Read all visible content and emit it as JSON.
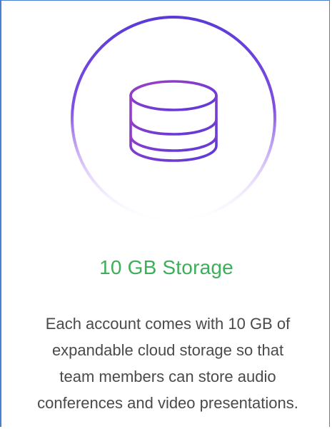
{
  "feature": {
    "icon": "database-icon",
    "accent_color": "#3fae5b",
    "ring_color": "#6a3bd6",
    "title": "10 GB Storage",
    "description_lines": [
      "Each account comes with 10 GB of",
      "expandable cloud storage so that",
      "team members can store audio",
      "conferences and video presentations."
    ]
  }
}
